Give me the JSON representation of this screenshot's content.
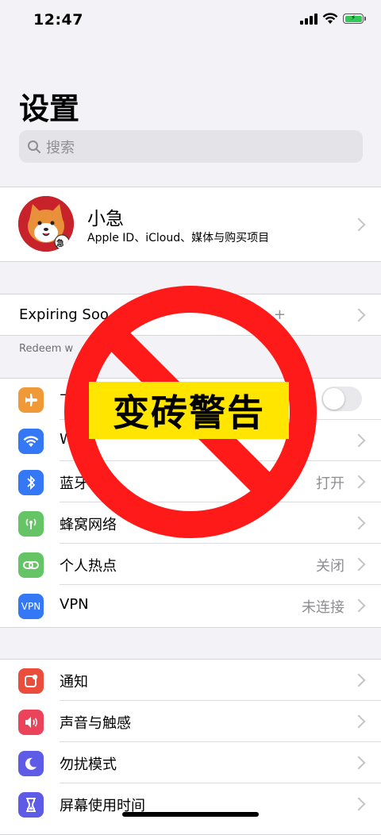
{
  "status": {
    "time": "12:47"
  },
  "title": "设置",
  "search": {
    "placeholder": "搜索"
  },
  "profile": {
    "name": "小急",
    "subtitle": "Apple ID、iCloud、媒体与购买项目",
    "avatar_badge": "急"
  },
  "promo": {
    "title": "Expiring Soo",
    "plus": "+",
    "redeem": "Redeem w"
  },
  "overlay": {
    "text": "变砖警告"
  },
  "connectivity": [
    {
      "label": "飞",
      "icon": "airplane-icon",
      "color": "#f09a37",
      "control": "toggle",
      "toggle_on": false
    },
    {
      "label": "W",
      "icon": "wifi-icon",
      "color": "#3478f6",
      "value": ""
    },
    {
      "label": "蓝牙",
      "icon": "bluetooth-icon",
      "color": "#3478f6",
      "value": "打开"
    },
    {
      "label": "蜂窝网络",
      "icon": "cellular-icon",
      "color": "#65c466",
      "value": ""
    },
    {
      "label": "个人热点",
      "icon": "hotspot-icon",
      "color": "#65c466",
      "value": "关闭"
    },
    {
      "label": "VPN",
      "icon": "vpn-icon",
      "color": "#3478f6",
      "icon_text": "VPN",
      "value": "未连接"
    }
  ],
  "general": [
    {
      "label": "通知",
      "icon": "notifications-icon",
      "color": "#eb4d3d"
    },
    {
      "label": "声音与触感",
      "icon": "sounds-icon",
      "color": "#eb445a"
    },
    {
      "label": "勿扰模式",
      "icon": "moon-icon",
      "color": "#5e5ce6"
    },
    {
      "label": "屏幕使用时间",
      "icon": "hourglass-icon",
      "color": "#5e5ce6"
    }
  ]
}
